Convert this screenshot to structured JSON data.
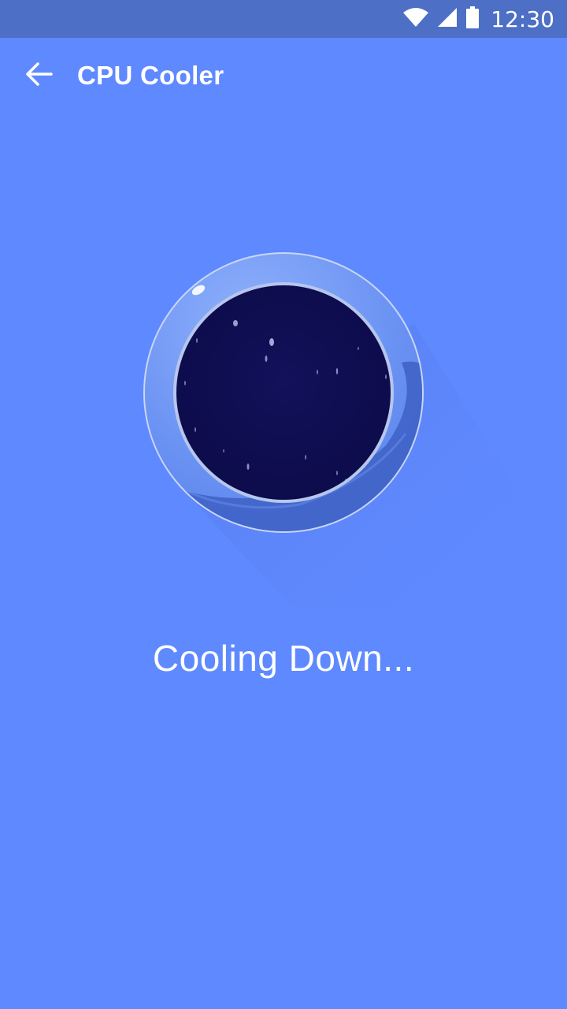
{
  "status_bar": {
    "time": "12:30",
    "icons": [
      "wifi-icon",
      "cellular-signal-icon",
      "battery-icon"
    ]
  },
  "app_bar": {
    "back_icon": "arrow-left-icon",
    "title": "CPU Cooler"
  },
  "main": {
    "status_message": "Cooling Down..."
  },
  "colors": {
    "background": "#5f89fe",
    "status_bar": "#4d6fc6",
    "cooler_core": "#0e0d50",
    "text": "#ffffff"
  }
}
